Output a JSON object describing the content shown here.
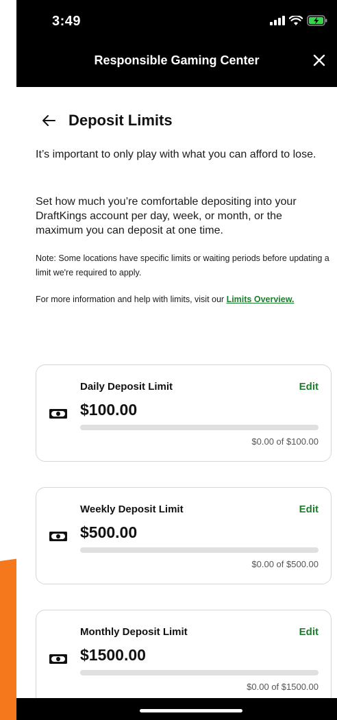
{
  "status_bar": {
    "time": "3:49",
    "icons": [
      "signal-icon",
      "wifi-icon",
      "battery-charging-icon"
    ]
  },
  "header": {
    "title": "Responsible Gaming Center",
    "close_icon": "close-icon"
  },
  "page": {
    "title": "Deposit Limits",
    "back_icon": "back-arrow-icon",
    "intro": "It’s important to only play with what you can afford to lose.",
    "description": "Set how much you’re comfortable depositing into your DraftKings account per day, week, or month, or the maximum you can deposit at one time.",
    "note": "Note: Some locations have specific limits or waiting periods before updating a limit we're required to apply.",
    "info_prefix": "For more information and help with limits, visit our ",
    "info_link": "Limits Overview."
  },
  "limits": [
    {
      "label": "Daily Deposit Limit",
      "edit_label": "Edit",
      "amount": "$100.00",
      "progress_text": "$0.00 of $100.00",
      "progress_fraction": 0
    },
    {
      "label": "Weekly Deposit Limit",
      "edit_label": "Edit",
      "amount": "$500.00",
      "progress_text": "$0.00 of $500.00",
      "progress_fraction": 0
    },
    {
      "label": "Monthly Deposit Limit",
      "edit_label": "Edit",
      "amount": "$1500.00",
      "progress_text": "$0.00 of $1500.00",
      "progress_fraction": 0
    }
  ],
  "colors": {
    "accent_green": "#1c7d2c",
    "header_bg": "#000000",
    "side_orange": "#f5781d"
  }
}
